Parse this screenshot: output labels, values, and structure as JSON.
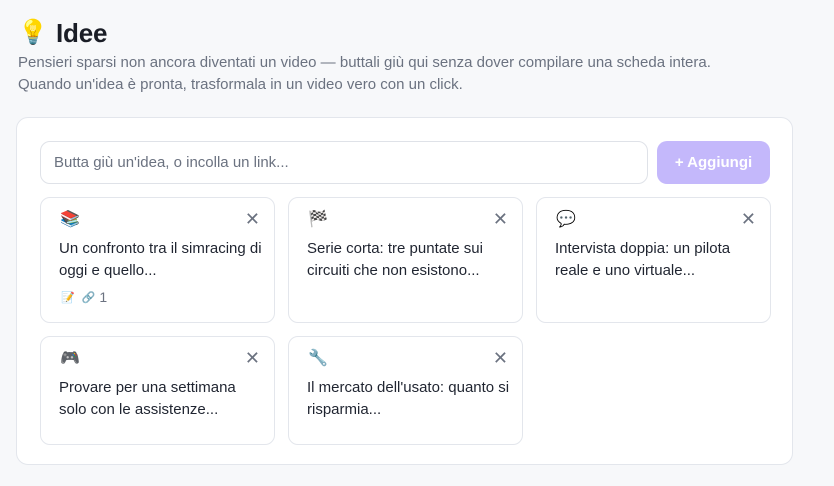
{
  "header": {
    "icon": "lightbulb-icon",
    "icon_glyph": "💡",
    "title": "Idee",
    "description_line1": "Pensieri sparsi non ancora diventati un video — buttali giù qui senza dover compilare una scheda intera.",
    "description_line2": "Quando un'idea è pronta, trasformala in un video vero con un click."
  },
  "composer": {
    "placeholder": "Butta giù un'idea, o incolla un link...",
    "value": "",
    "add_label": "+ Aggiungi",
    "add_color": "#c4b8fb"
  },
  "ideas": [
    {
      "icon": "stacked-books-icon",
      "icon_glyph": "📚",
      "text": "Un confronto tra il simracing di oggi e quello...",
      "close_glyph": "✕",
      "meta": {
        "note_glyph": "📝",
        "link_glyph": "🔗",
        "link_count": "1"
      }
    },
    {
      "icon": "checkered-flag-icon",
      "icon_glyph": "🏁",
      "text": "Serie corta: tre puntate sui circuiti che non esistono...",
      "close_glyph": "✕"
    },
    {
      "icon": "speech-bubble-icon",
      "icon_glyph": "💬",
      "text": "Intervista doppia: un pilota reale e uno virtuale...",
      "close_glyph": "✕"
    },
    {
      "icon": "gamepad-icon",
      "icon_glyph": "🎮",
      "text": "Provare per una settimana solo con le assistenze...",
      "close_glyph": "✕"
    },
    {
      "icon": "wrench-icon",
      "icon_glyph": "🔧",
      "text": "Il mercato dell'usato: quanto si risparmia...",
      "close_glyph": "✕"
    }
  ]
}
